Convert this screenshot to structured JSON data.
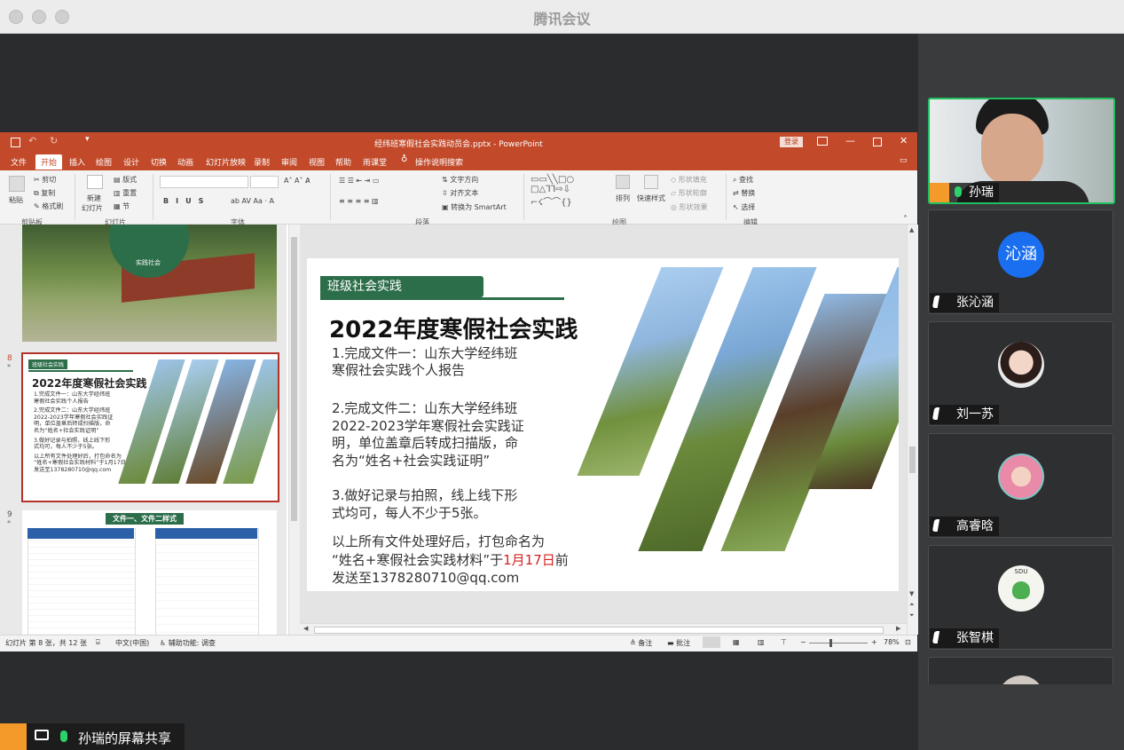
{
  "app_title": "腾讯会议",
  "ppt": {
    "title": "经纬班寒假社会实践动员会.pptx - PowerPoint",
    "login": "登录",
    "tabs": [
      "文件",
      "开始",
      "插入",
      "绘图",
      "设计",
      "切换",
      "动画",
      "幻灯片放映",
      "录制",
      "审阅",
      "视图",
      "帮助",
      "雨课堂"
    ],
    "tell_me": "操作说明搜索",
    "ribbon": {
      "cut": "剪切",
      "copy": "复制",
      "format_painter": "格式刷",
      "paste": "粘贴",
      "new_slide": "新建",
      "new_slide2": "幻灯片",
      "layout": "版式",
      "reset": "重置",
      "section": "节",
      "text_direction": "文字方向",
      "align_text": "对齐文本",
      "smartart": "转换为 SmartArt",
      "arrange": "排列",
      "quick_styles": "快速样式",
      "shape_fill": "形状填充",
      "shape_outline": "形状轮廓",
      "shape_effects": "形状效果",
      "find": "查找",
      "replace": "替换",
      "select": "选择",
      "groups": [
        "剪贴板",
        "幻灯片",
        "字体",
        "段落",
        "绘图",
        "编辑"
      ]
    },
    "thumbs": {
      "num8": "8",
      "num9": "9",
      "t7_badge": "实践社会",
      "t8_tag": "班级社会实践",
      "t8_title": "2022年度寒假社会实践",
      "t8_lines": [
        "1.完成文件一：山东大学经纬班",
        "寒假社会实践个人报告",
        "",
        "2.完成文件二：山东大学经纬班",
        "2022-2023学年寒假社会实践证",
        "明，单位盖章后转成扫描版，命",
        "名为“姓名+社会实践证明”",
        "",
        "3.做好记录与拍照，线上线下形",
        "式均可，每人不少于5张。",
        "",
        "以上所有文件处理好后，打包命名为",
        "“姓名+寒假社会实践材料”于1月17日前",
        "发送至1378280710@qq.com"
      ],
      "t9_title": "文件一、文件二样式"
    },
    "slide": {
      "tag": "班级社会实践",
      "title": "2022年度寒假社会实践",
      "p1": [
        "1.完成文件一：山东大学经纬班",
        "寒假社会实践个人报告"
      ],
      "p2": [
        "2.完成文件二：山东大学经纬班",
        "2022-2023学年寒假社会实践证",
        "明，单位盖章后转成扫描版，命",
        "名为“姓名+社会实践证明”"
      ],
      "p3": [
        "3.做好记录与拍照，线上线下形",
        "式均可，每人不少于5张。"
      ],
      "p4a": "以上所有文件处理好后，打包命名为",
      "p4b_pre": "“姓名+寒假社会实践材料”于",
      "p4b_red": "1月17日",
      "p4b_post": "前",
      "p4c": "发送至1378280710@qq.com",
      "red_color": "#d42020",
      "green_color": "#2d6e4a"
    },
    "status": {
      "slide_info": "幻灯片 第 8 张，共 12 张",
      "language": "中文(中国)",
      "accessibility": "辅助功能: 调查",
      "notes": "备注",
      "comments": "批注",
      "zoom": "78%"
    }
  },
  "participants": [
    {
      "name": "孙瑞",
      "video": true,
      "mic": "on"
    },
    {
      "name": "张沁涵",
      "avatar_text": "沁涵",
      "mic": "muted"
    },
    {
      "name": "刘一苏",
      "mic": "muted"
    },
    {
      "name": "高睿晗",
      "mic": "muted"
    },
    {
      "name": "张智棋",
      "avatar_text": "SDU",
      "mic": "muted"
    }
  ],
  "share_label": "孙瑞的屏幕共享",
  "colors": {
    "ppt_accent": "#c24a2a",
    "active_speaker": "#20c060",
    "avatar_blue": "#1a6ef0"
  }
}
